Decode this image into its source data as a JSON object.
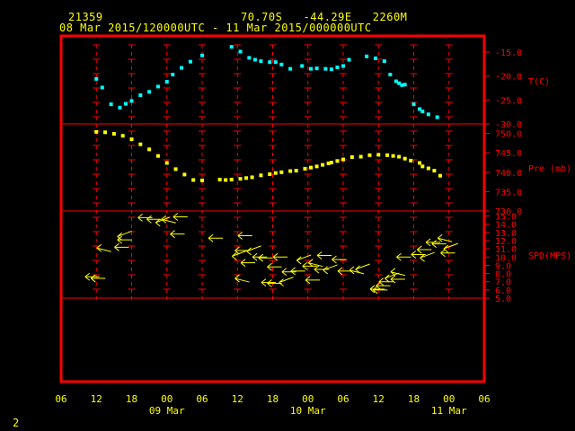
{
  "header": {
    "station_id": "21359",
    "location": "70.70S   -44.29E   2260M",
    "period": "08 Mar 2015/120000UTC - 11 Mar 2015/000000UTC"
  },
  "footer": {
    "page_number": "2"
  },
  "colors": {
    "frame": "#ff0000",
    "grid": "#ff0000",
    "text": "#ffff00",
    "temperature": "#00ffff",
    "pressure": "#ffff00",
    "wind": "#ffff00"
  },
  "chart_data": {
    "type": "scatter",
    "x_axis": {
      "hour_ticks": [
        "06",
        "12",
        "18",
        "00",
        "06",
        "12",
        "18",
        "00",
        "06",
        "12",
        "18",
        "00",
        "06"
      ],
      "hour_tick_times": [
        -6,
        0,
        6,
        12,
        18,
        24,
        30,
        36,
        42,
        48,
        54,
        60,
        66
      ],
      "day_labels": [
        {
          "label": "09 Mar",
          "at": 12
        },
        {
          "label": "10 Mar",
          "at": 36
        },
        {
          "label": "11 Mar",
          "at": 60
        }
      ],
      "range": [
        -6,
        66
      ]
    },
    "panels": [
      {
        "name": "temperature",
        "label": "T(C)",
        "ylim": [
          -30,
          -12
        ],
        "ticks": [
          -15.0,
          -20.0,
          -25.0,
          -30.0
        ],
        "tick_labels": [
          "-15.0",
          "-20.0",
          "-25.0",
          "-30.0"
        ],
        "points": [
          [
            0,
            -20.6
          ],
          [
            1,
            -22.4
          ],
          [
            2.5,
            -25.9
          ],
          [
            4,
            -26.6
          ],
          [
            5,
            -25.8
          ],
          [
            6,
            -25.2
          ],
          [
            7.5,
            -24.0
          ],
          [
            9,
            -23.3
          ],
          [
            10.5,
            -22.2
          ],
          [
            12,
            -21.2
          ],
          [
            13,
            -19.7
          ],
          [
            14.5,
            -18.3
          ],
          [
            16,
            -17.0
          ],
          [
            18,
            -15.7
          ],
          [
            23,
            -13.9
          ],
          [
            24.5,
            -14.9
          ],
          [
            26,
            -16.2
          ],
          [
            27,
            -16.6
          ],
          [
            28,
            -16.9
          ],
          [
            29.5,
            -17.1
          ],
          [
            30.5,
            -17.1
          ],
          [
            31.5,
            -17.6
          ],
          [
            33,
            -18.5
          ],
          [
            35,
            -17.9
          ],
          [
            36.5,
            -18.5
          ],
          [
            37.5,
            -18.4
          ],
          [
            39,
            -18.5
          ],
          [
            40,
            -18.6
          ],
          [
            41,
            -18.2
          ],
          [
            42,
            -17.9
          ],
          [
            43,
            -16.6
          ],
          [
            46,
            -15.9
          ],
          [
            47.5,
            -16.3
          ],
          [
            49,
            -16.9
          ],
          [
            50,
            -19.7
          ],
          [
            51,
            -21.1
          ],
          [
            51.5,
            -21.5
          ],
          [
            52,
            -21.9
          ],
          [
            52.5,
            -21.8
          ],
          [
            54,
            -25.9
          ],
          [
            55,
            -26.9
          ],
          [
            55.5,
            -27.4
          ],
          [
            56.5,
            -28.0
          ],
          [
            58,
            -28.6
          ]
        ]
      },
      {
        "name": "pressure",
        "label": "Pre (mb)",
        "ylim": [
          730,
          752
        ],
        "ticks": [
          730.0,
          735.0,
          740.0,
          745.0,
          750.0
        ],
        "tick_labels": [
          "730.0",
          "735.0",
          "740.0",
          "745.0",
          "750.0"
        ],
        "points": [
          [
            0,
            750.4
          ],
          [
            1.5,
            750.3
          ],
          [
            3,
            749.9
          ],
          [
            4.5,
            749.4
          ],
          [
            6,
            748.5
          ],
          [
            7.5,
            747.2
          ],
          [
            9,
            745.9
          ],
          [
            10.5,
            744.2
          ],
          [
            12,
            742.4
          ],
          [
            13.5,
            740.8
          ],
          [
            15,
            739.4
          ],
          [
            16.5,
            738.0
          ],
          [
            18,
            737.9
          ],
          [
            21,
            738.1
          ],
          [
            22,
            738.0
          ],
          [
            23,
            738.1
          ],
          [
            24.5,
            738.3
          ],
          [
            25.5,
            738.5
          ],
          [
            26.5,
            738.7
          ],
          [
            28,
            739.2
          ],
          [
            29.5,
            739.5
          ],
          [
            30.5,
            739.8
          ],
          [
            31.5,
            740.0
          ],
          [
            33,
            740.3
          ],
          [
            34,
            740.4
          ],
          [
            35.5,
            740.9
          ],
          [
            36.5,
            741.2
          ],
          [
            37.5,
            741.5
          ],
          [
            38.5,
            741.9
          ],
          [
            39.5,
            742.3
          ],
          [
            40,
            742.5
          ],
          [
            41,
            742.9
          ],
          [
            42,
            743.3
          ],
          [
            43.5,
            743.9
          ],
          [
            45,
            744.0
          ],
          [
            46.5,
            744.4
          ],
          [
            48,
            744.5
          ],
          [
            49.5,
            744.4
          ],
          [
            50.5,
            744.2
          ],
          [
            51.5,
            744.0
          ],
          [
            52.5,
            743.5
          ],
          [
            53.5,
            743.0
          ],
          [
            55,
            742.4
          ],
          [
            55.5,
            741.5
          ],
          [
            56.5,
            741.0
          ],
          [
            57.5,
            740.4
          ],
          [
            58.5,
            739.1
          ]
        ]
      },
      {
        "name": "wind",
        "label": "SPD(MPS)",
        "ylim": [
          5,
          15.5
        ],
        "ticks": [
          5.0,
          6.0,
          7.0,
          8.0,
          9.0,
          10.0,
          11.0,
          12.0,
          13.0,
          14.0,
          15.0
        ],
        "tick_labels": [
          "5.0",
          "6.0",
          "7.0",
          "8.0",
          "9.0",
          "10.0",
          "11.0",
          "12.0",
          "13.0",
          "14.0",
          "15.0"
        ],
        "points": [
          [
            -1,
            7.6
          ],
          [
            0,
            7.4
          ],
          [
            1,
            11.1
          ],
          [
            4.5,
            12.5
          ],
          [
            4.5,
            12.1
          ],
          [
            4,
            11.2
          ],
          [
            8,
            14.8
          ],
          [
            9.5,
            14.6
          ],
          [
            11,
            14.2
          ],
          [
            12,
            14.6
          ],
          [
            14,
            14.9
          ],
          [
            13.5,
            12.8
          ],
          [
            20,
            12.3
          ],
          [
            24,
            10.1
          ],
          [
            24.5,
            10.8
          ],
          [
            25,
            12.6
          ],
          [
            24.5,
            7.4
          ],
          [
            25.5,
            9.3
          ],
          [
            26.5,
            10.7
          ],
          [
            27.5,
            10.0
          ],
          [
            28.5,
            9.9
          ],
          [
            29,
            6.9
          ],
          [
            30,
            6.8
          ],
          [
            32,
            6.9
          ],
          [
            30,
            8.8
          ],
          [
            31,
            10.0
          ],
          [
            32.5,
            8.2
          ],
          [
            34,
            8.3
          ],
          [
            35,
            9.6
          ],
          [
            36,
            8.9
          ],
          [
            37,
            9.3
          ],
          [
            36.5,
            7.2
          ],
          [
            38,
            8.5
          ],
          [
            39.5,
            8.4
          ],
          [
            41,
            9.7
          ],
          [
            38.5,
            10.2
          ],
          [
            42,
            8.3
          ],
          [
            44,
            8.4
          ],
          [
            45,
            8.5
          ],
          [
            47.5,
            6.1
          ],
          [
            48,
            6.0
          ],
          [
            48.5,
            6.5
          ],
          [
            49,
            7.0
          ],
          [
            50,
            7.4
          ],
          [
            51,
            8.2
          ],
          [
            51,
            7.3
          ],
          [
            54.5,
            10.3
          ],
          [
            55.5,
            10.9
          ],
          [
            56,
            9.9
          ],
          [
            57,
            11.8
          ],
          [
            58,
            11.6
          ],
          [
            59,
            12.3
          ],
          [
            59.5,
            10.5
          ],
          [
            60,
            11.0
          ],
          [
            52,
            10.0
          ]
        ]
      }
    ]
  }
}
